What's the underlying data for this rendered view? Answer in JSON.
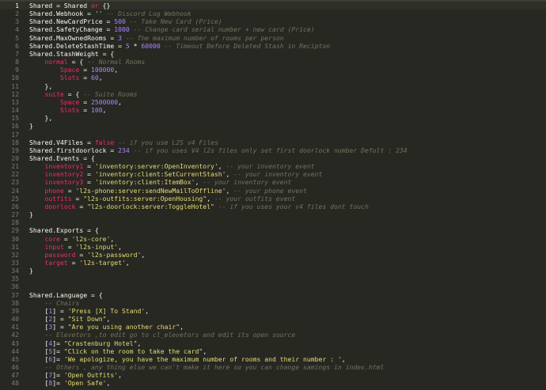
{
  "editor": {
    "colors": {
      "background": "#272822",
      "keyword": "#f92672",
      "number": "#ae81ff",
      "string": "#e6db74",
      "comment": "#75715e",
      "text": "#f8f8f2"
    },
    "active_line": 1,
    "lines": [
      {
        "n": "1",
        "tokens": [
          [
            "var",
            "Shared"
          ],
          [
            "pun",
            " = "
          ],
          [
            "var",
            "Shared"
          ],
          [
            "kw",
            " or "
          ],
          [
            "pun",
            "{}"
          ]
        ]
      },
      {
        "n": "2",
        "tokens": [
          [
            "var",
            "Shared"
          ],
          [
            "pun",
            "."
          ],
          [
            "var",
            "Webhook"
          ],
          [
            "pun",
            " = "
          ],
          [
            "str",
            "''"
          ],
          [
            "cmt",
            " -- Discord Log Webhook"
          ]
        ]
      },
      {
        "n": "3",
        "tokens": [
          [
            "var",
            "Shared"
          ],
          [
            "pun",
            "."
          ],
          [
            "var",
            "NewCardPrice"
          ],
          [
            "pun",
            " = "
          ],
          [
            "num",
            "500"
          ],
          [
            "cmt",
            " -- Take New Card (Price)"
          ]
        ]
      },
      {
        "n": "4",
        "tokens": [
          [
            "var",
            "Shared"
          ],
          [
            "pun",
            "."
          ],
          [
            "var",
            "SafetyChange"
          ],
          [
            "pun",
            " = "
          ],
          [
            "num",
            "1000"
          ],
          [
            "cmt",
            " -- Change card serial number + new card (Price)"
          ]
        ]
      },
      {
        "n": "5",
        "tokens": [
          [
            "var",
            "Shared"
          ],
          [
            "pun",
            "."
          ],
          [
            "var",
            "MaxOwnedRooms"
          ],
          [
            "pun",
            " = "
          ],
          [
            "num",
            "3"
          ],
          [
            "cmt",
            " -- The maximum number of rooms per person"
          ]
        ]
      },
      {
        "n": "6",
        "tokens": [
          [
            "var",
            "Shared"
          ],
          [
            "pun",
            "."
          ],
          [
            "var",
            "DeleteStashTime"
          ],
          [
            "pun",
            " = "
          ],
          [
            "num",
            "5"
          ],
          [
            "pun",
            " * "
          ],
          [
            "num",
            "60000"
          ],
          [
            "cmt",
            " -- Timeout Before Deleted Stash in Recipton"
          ]
        ]
      },
      {
        "n": "7",
        "tokens": [
          [
            "var",
            "Shared"
          ],
          [
            "pun",
            "."
          ],
          [
            "var",
            "StashWeight"
          ],
          [
            "pun",
            " = {"
          ]
        ]
      },
      {
        "n": "8",
        "tokens": [
          [
            "pun",
            "    "
          ],
          [
            "key",
            "normal"
          ],
          [
            "pun",
            " = { "
          ],
          [
            "cmt",
            "-- Normal Rooms"
          ]
        ]
      },
      {
        "n": "9",
        "tokens": [
          [
            "pun",
            "        "
          ],
          [
            "key",
            "Space"
          ],
          [
            "pun",
            " = "
          ],
          [
            "num",
            "100000"
          ],
          [
            "pun",
            ","
          ]
        ]
      },
      {
        "n": "10",
        "tokens": [
          [
            "pun",
            "        "
          ],
          [
            "key",
            "Slots"
          ],
          [
            "pun",
            " = "
          ],
          [
            "num",
            "60"
          ],
          [
            "pun",
            ","
          ]
        ]
      },
      {
        "n": "11",
        "tokens": [
          [
            "pun",
            "    },"
          ]
        ]
      },
      {
        "n": "12",
        "tokens": [
          [
            "pun",
            "    "
          ],
          [
            "key",
            "suite"
          ],
          [
            "pun",
            " = { "
          ],
          [
            "cmt",
            "-- Suite Rooms"
          ]
        ]
      },
      {
        "n": "13",
        "tokens": [
          [
            "pun",
            "        "
          ],
          [
            "key",
            "Space"
          ],
          [
            "pun",
            " = "
          ],
          [
            "num",
            "2500000"
          ],
          [
            "pun",
            ","
          ]
        ]
      },
      {
        "n": "14",
        "tokens": [
          [
            "pun",
            "        "
          ],
          [
            "key",
            "Slots"
          ],
          [
            "pun",
            " = "
          ],
          [
            "num",
            "100"
          ],
          [
            "pun",
            ","
          ]
        ]
      },
      {
        "n": "15",
        "tokens": [
          [
            "pun",
            "    },"
          ]
        ]
      },
      {
        "n": "16",
        "tokens": [
          [
            "pun",
            "}"
          ]
        ]
      },
      {
        "n": "17",
        "tokens": []
      },
      {
        "n": "18",
        "tokens": [
          [
            "var",
            "Shared"
          ],
          [
            "pun",
            "."
          ],
          [
            "var",
            "V4Files"
          ],
          [
            "pun",
            " = "
          ],
          [
            "kw",
            "false"
          ],
          [
            "cmt",
            " -- if you use L2S v4 Files"
          ]
        ]
      },
      {
        "n": "19",
        "tokens": [
          [
            "var",
            "Shared"
          ],
          [
            "pun",
            "."
          ],
          [
            "var",
            "firstdoorlock"
          ],
          [
            "pun",
            " = "
          ],
          [
            "num",
            "234"
          ],
          [
            "cmt",
            " -- if you uses V4 l2s files only set first doorlock number Defult : 234"
          ]
        ]
      },
      {
        "n": "20",
        "tokens": [
          [
            "var",
            "Shared"
          ],
          [
            "pun",
            "."
          ],
          [
            "var",
            "Events"
          ],
          [
            "pun",
            " = {"
          ]
        ]
      },
      {
        "n": "21",
        "tokens": [
          [
            "pun",
            "    "
          ],
          [
            "key",
            "inventory1"
          ],
          [
            "pun",
            " = "
          ],
          [
            "str",
            "'inventory:server:OpenInventory'"
          ],
          [
            "pun",
            ", "
          ],
          [
            "cmt",
            "-- your inventory event"
          ]
        ]
      },
      {
        "n": "22",
        "tokens": [
          [
            "pun",
            "    "
          ],
          [
            "key",
            "inventory2"
          ],
          [
            "pun",
            " = "
          ],
          [
            "str",
            "'inventory:client:SetCurrentStash'"
          ],
          [
            "pun",
            ", "
          ],
          [
            "cmt",
            "-- your inventory event"
          ]
        ]
      },
      {
        "n": "23",
        "tokens": [
          [
            "pun",
            "    "
          ],
          [
            "key",
            "inventory3"
          ],
          [
            "pun",
            " = "
          ],
          [
            "str",
            "'inventory:client:ItemBox'"
          ],
          [
            "pun",
            ", "
          ],
          [
            "cmt",
            "-- your inventory event"
          ]
        ]
      },
      {
        "n": "24",
        "tokens": [
          [
            "pun",
            "    "
          ],
          [
            "key",
            "phone"
          ],
          [
            "pun",
            " = "
          ],
          [
            "str",
            "'l2s-phone:server:sendNewMailToOffline'"
          ],
          [
            "pun",
            ", "
          ],
          [
            "cmt",
            "-- your phone event"
          ]
        ]
      },
      {
        "n": "25",
        "tokens": [
          [
            "pun",
            "    "
          ],
          [
            "key",
            "outfits"
          ],
          [
            "pun",
            " = "
          ],
          [
            "str",
            "\"l2s-outfits:server:OpenHousing\""
          ],
          [
            "pun",
            ", "
          ],
          [
            "cmt",
            "-- your outfits event"
          ]
        ]
      },
      {
        "n": "26",
        "tokens": [
          [
            "pun",
            "    "
          ],
          [
            "key",
            "doorlock"
          ],
          [
            "pun",
            " = "
          ],
          [
            "str",
            "\"l2s-doorlock:server:ToggleHotel\""
          ],
          [
            "cmt",
            " -- if you uses your v4 files dont touch"
          ]
        ]
      },
      {
        "n": "27",
        "tokens": [
          [
            "pun",
            "}"
          ]
        ]
      },
      {
        "n": "28",
        "tokens": []
      },
      {
        "n": "29",
        "tokens": [
          [
            "var",
            "Shared"
          ],
          [
            "pun",
            "."
          ],
          [
            "var",
            "Exports"
          ],
          [
            "pun",
            " = {"
          ]
        ]
      },
      {
        "n": "30",
        "tokens": [
          [
            "pun",
            "    "
          ],
          [
            "key",
            "core"
          ],
          [
            "pun",
            " = "
          ],
          [
            "str",
            "'l2s-core'"
          ],
          [
            "pun",
            ","
          ]
        ]
      },
      {
        "n": "31",
        "tokens": [
          [
            "pun",
            "    "
          ],
          [
            "key",
            "input"
          ],
          [
            "pun",
            " = "
          ],
          [
            "str",
            "'l2s-input'"
          ],
          [
            "pun",
            ","
          ]
        ]
      },
      {
        "n": "32",
        "tokens": [
          [
            "pun",
            "    "
          ],
          [
            "key",
            "password"
          ],
          [
            "pun",
            " = "
          ],
          [
            "str",
            "'l2s-password'"
          ],
          [
            "pun",
            ","
          ]
        ]
      },
      {
        "n": "33",
        "tokens": [
          [
            "pun",
            "    "
          ],
          [
            "key",
            "target"
          ],
          [
            "pun",
            " = "
          ],
          [
            "str",
            "'l2s-target'"
          ],
          [
            "pun",
            ","
          ]
        ]
      },
      {
        "n": "34",
        "tokens": [
          [
            "pun",
            "}"
          ]
        ]
      },
      {
        "n": "35",
        "tokens": []
      },
      {
        "n": "36",
        "tokens": []
      },
      {
        "n": "37",
        "tokens": [
          [
            "var",
            "Shared"
          ],
          [
            "pun",
            "."
          ],
          [
            "var",
            "Language"
          ],
          [
            "pun",
            " = {"
          ]
        ]
      },
      {
        "n": "38",
        "tokens": [
          [
            "pun",
            "    "
          ],
          [
            "cmt",
            "-- Chairs"
          ]
        ]
      },
      {
        "n": "39",
        "tokens": [
          [
            "pun",
            "    "
          ],
          [
            "pun",
            "["
          ],
          [
            "num",
            "1"
          ],
          [
            "pun",
            "] = "
          ],
          [
            "str",
            "'Press [X] To Stand'"
          ],
          [
            "pun",
            ","
          ]
        ]
      },
      {
        "n": "40",
        "tokens": [
          [
            "pun",
            "    "
          ],
          [
            "pun",
            "["
          ],
          [
            "num",
            "2"
          ],
          [
            "pun",
            "] = "
          ],
          [
            "str",
            "\"Sit Down\""
          ],
          [
            "pun",
            ","
          ]
        ]
      },
      {
        "n": "41",
        "tokens": [
          [
            "pun",
            "    "
          ],
          [
            "pun",
            "["
          ],
          [
            "num",
            "3"
          ],
          [
            "pun",
            "] = "
          ],
          [
            "str",
            "\"Are you using another chair\""
          ],
          [
            "pun",
            ","
          ]
        ]
      },
      {
        "n": "42",
        "tokens": [
          [
            "pun",
            "    "
          ],
          [
            "cmt",
            "-- Elevetors ,to edit go to cl_elevetors and edit its open source"
          ]
        ]
      },
      {
        "n": "43",
        "tokens": [
          [
            "pun",
            "    "
          ],
          [
            "pun",
            "["
          ],
          [
            "num",
            "4"
          ],
          [
            "pun",
            "]= "
          ],
          [
            "str",
            "\"Crastenburg Hotel\""
          ],
          [
            "pun",
            ","
          ]
        ]
      },
      {
        "n": "44",
        "tokens": [
          [
            "pun",
            "    "
          ],
          [
            "pun",
            "["
          ],
          [
            "num",
            "5"
          ],
          [
            "pun",
            "]= "
          ],
          [
            "str",
            "\"Click on the room to take the card\""
          ],
          [
            "pun",
            ","
          ]
        ]
      },
      {
        "n": "45",
        "tokens": [
          [
            "pun",
            "    "
          ],
          [
            "pun",
            "["
          ],
          [
            "num",
            "6"
          ],
          [
            "pun",
            "]= "
          ],
          [
            "str",
            "'We apologize, you have the maximum number of rooms and their number : '"
          ],
          [
            "pun",
            ","
          ]
        ]
      },
      {
        "n": "46",
        "tokens": [
          [
            "pun",
            "    "
          ],
          [
            "cmt",
            "-- Others , any thing else we can't make it here so you can change samings in index.html"
          ]
        ]
      },
      {
        "n": "47",
        "tokens": [
          [
            "pun",
            "    "
          ],
          [
            "pun",
            "["
          ],
          [
            "num",
            "7"
          ],
          [
            "pun",
            "]= "
          ],
          [
            "str",
            "'Open Outfits'"
          ],
          [
            "pun",
            ","
          ]
        ]
      },
      {
        "n": "48",
        "tokens": [
          [
            "pun",
            "    "
          ],
          [
            "pun",
            "["
          ],
          [
            "num",
            "8"
          ],
          [
            "pun",
            "]= "
          ],
          [
            "str",
            "'Open Safe'"
          ],
          [
            "pun",
            ","
          ]
        ]
      }
    ]
  }
}
